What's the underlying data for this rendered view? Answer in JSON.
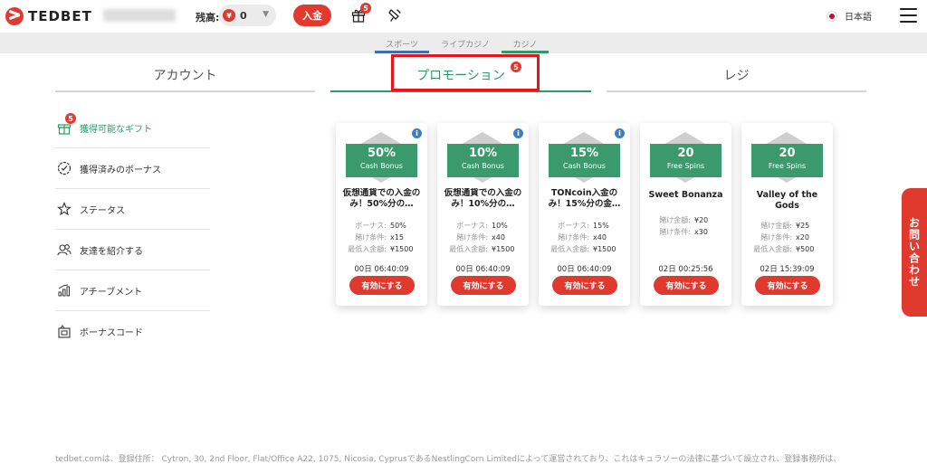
{
  "header": {
    "brand": "TEDBET",
    "balance_label": "残高:",
    "currency_symbol": "¥",
    "balance_value": "0",
    "deposit_label": "入金",
    "gift_badge": "5",
    "language": "日本語"
  },
  "subnav": {
    "tabs": [
      {
        "label": "スポーツ",
        "color": "#3b6fb5"
      },
      {
        "label": "ライブカジノ",
        "color": "#ececec"
      },
      {
        "label": "カジノ",
        "color": "#2e9a6b"
      }
    ]
  },
  "main_tabs": [
    {
      "label": "アカウント"
    },
    {
      "label": "プロモーション",
      "badge": "5"
    },
    {
      "label": "レジ"
    }
  ],
  "sidebar": {
    "items": [
      {
        "label": "獲得可能なギフト",
        "badge": "5"
      },
      {
        "label": "獲得済みのボーナス"
      },
      {
        "label": "ステータス"
      },
      {
        "label": "友達を紹介する"
      },
      {
        "label": "アチーブメント"
      },
      {
        "label": "ボーナスコード"
      }
    ]
  },
  "cards": [
    {
      "big": "50%",
      "small": "Cash Bonus",
      "title": "仮想通貨での入金のみ！50%分の…",
      "rows": [
        {
          "k": "ボーナス:",
          "v": "50%"
        },
        {
          "k": "賭け条件:",
          "v": "x15"
        },
        {
          "k": "最低入金額:",
          "v": "¥1500"
        }
      ],
      "timer": "00日  06:40:09",
      "button": "有効にする",
      "info": "i"
    },
    {
      "big": "10%",
      "small": "Cash Bonus",
      "title": "仮想通貨での入金のみ！10%分の…",
      "rows": [
        {
          "k": "ボーナス:",
          "v": "10%"
        },
        {
          "k": "賭け条件:",
          "v": "x40"
        },
        {
          "k": "最低入金額:",
          "v": "¥1500"
        }
      ],
      "timer": "00日  06:40:09",
      "button": "有効にする",
      "info": "i"
    },
    {
      "big": "15%",
      "small": "Cash Bonus",
      "title": "TONcoin入金のみ！15%分の金…",
      "rows": [
        {
          "k": "ボーナス:",
          "v": "15%"
        },
        {
          "k": "賭け条件:",
          "v": "x40"
        },
        {
          "k": "最低入金額:",
          "v": "¥1500"
        }
      ],
      "timer": "00日  06:40:09",
      "button": "有効にする",
      "info": "i"
    },
    {
      "big": "20",
      "small": "Free Spins",
      "title": "Sweet Bonanza",
      "rows": [
        {
          "k": "賭け金額:",
          "v": "¥20"
        },
        {
          "k": "賭け条件:",
          "v": "x30"
        }
      ],
      "timer": "02日  00:25:56",
      "button": "有効にする"
    },
    {
      "big": "20",
      "small": "Free Spins",
      "title": "Valley of the Gods",
      "rows": [
        {
          "k": "賭け金額:",
          "v": "¥25"
        },
        {
          "k": "賭け条件:",
          "v": "x20"
        },
        {
          "k": "最低入金額:",
          "v": "¥500"
        }
      ],
      "timer": "02日  15:39:09",
      "button": "有効にする"
    }
  ],
  "contact_label": "お問い合わせ",
  "footer_text": "tedbet.comは、登録住所： Cytron, 30, 2nd Floor, Flat/Office A22, 1075, Nicosia, CyprusであるNestlingCorn Limitedによって運営されており、これはキュラソーの法律に基づいて設立され、登録事務所は、"
}
